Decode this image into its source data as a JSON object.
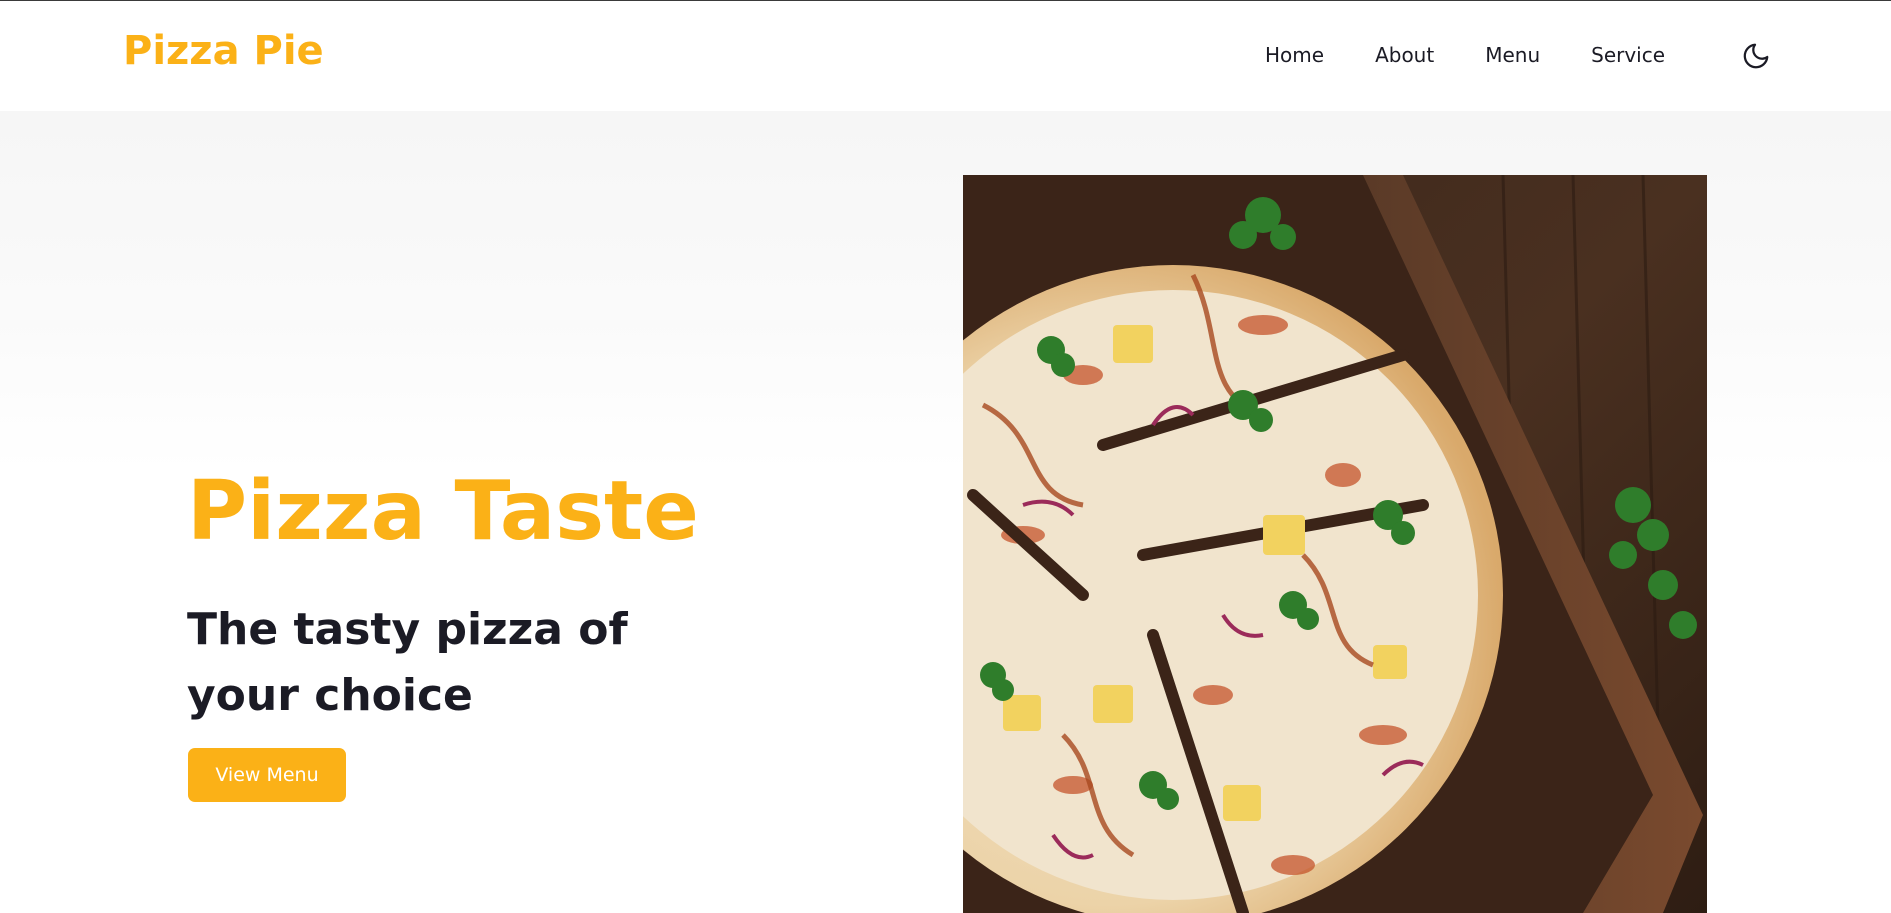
{
  "brand": {
    "logo_text": "Pizza Pie",
    "accent_color": "#fbb117",
    "text_color": "#1b1b25"
  },
  "nav": {
    "items": [
      {
        "label": "Home"
      },
      {
        "label": "About"
      },
      {
        "label": "Menu"
      },
      {
        "label": "Service"
      }
    ],
    "theme_toggle_icon": "moon-icon"
  },
  "hero": {
    "title": "Pizza Taste",
    "subtitle": "The tasty pizza of your choice",
    "cta_label": "View Menu",
    "image": "pizza-on-wooden-board"
  }
}
